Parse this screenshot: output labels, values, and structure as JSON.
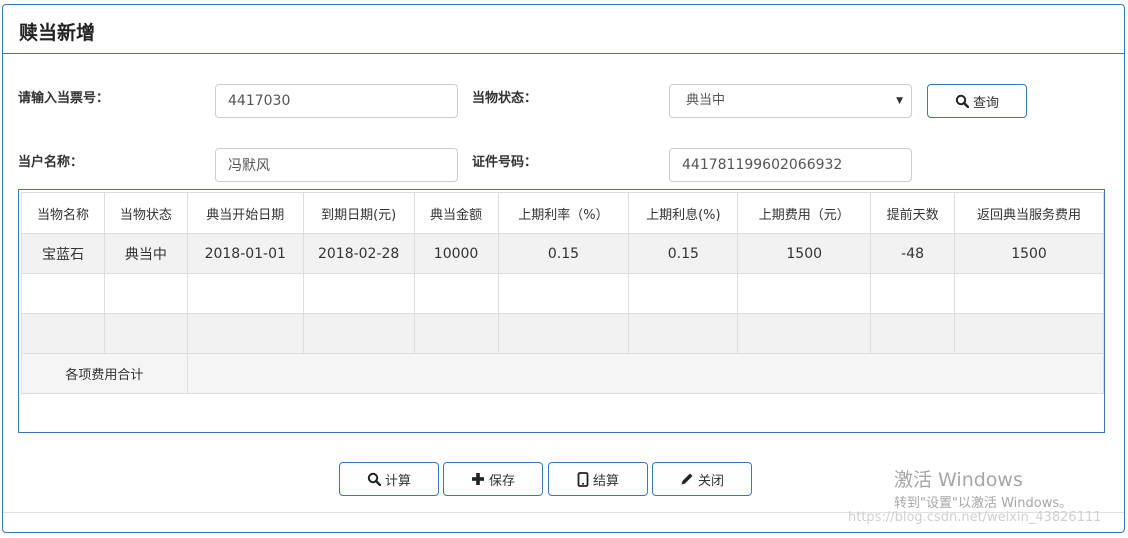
{
  "panel": {
    "title": "赎当新增"
  },
  "form": {
    "ticket_label": "请输入当票号：",
    "ticket_value": "4417030",
    "status_label": "当物状态：",
    "status_value": "典当中",
    "query_label": "查询",
    "customer_label": "当户名称：",
    "customer_value": "冯默风",
    "id_label": "证件号码：",
    "id_value": "441781199602066932"
  },
  "table": {
    "columns": [
      "当物名称",
      "当物状态",
      "典当开始日期",
      "到期日期(元)",
      "典当金额",
      "上期利率（%）",
      "上期利息(%)",
      "上期费用（元）",
      "提前天数",
      "返回典当服务费用"
    ],
    "rows": [
      [
        "宝蓝石",
        "典当中",
        "2018-01-01",
        "2018-02-28",
        "10000",
        "0.15",
        "0.15",
        "1500",
        "-48",
        "1500"
      ]
    ],
    "summary_label": "各项费用合计"
  },
  "actions": {
    "calculate": "计算",
    "save": "保存",
    "settle": "结算",
    "close": "关闭"
  },
  "watermark": {
    "line1": "激活 Windows",
    "line2": "转到\"设置\"以激活 Windows。",
    "url": "https://blog.csdn.net/weixin_43826111"
  }
}
